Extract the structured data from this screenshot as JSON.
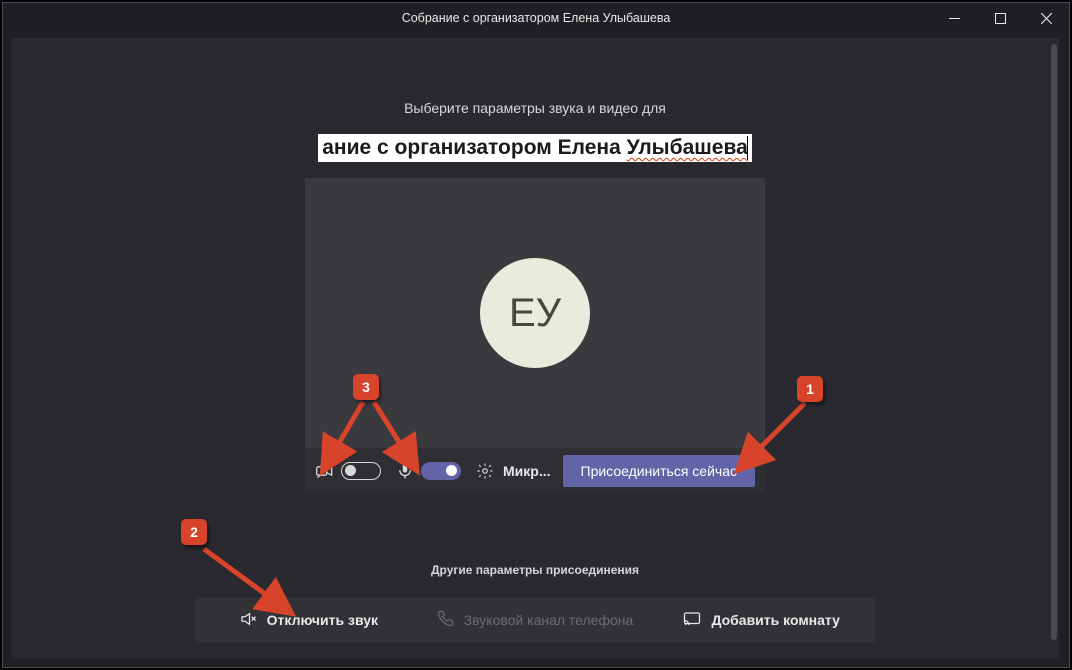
{
  "window": {
    "title": "Собрание с организатором Елена Улыбашева"
  },
  "heading": "Выберите параметры звука и видео для",
  "meeting_name": {
    "prefix": "ание с организатором Елена ",
    "wavy": "Улыбашева"
  },
  "avatar_initials": "ЕУ",
  "controls": {
    "device_label": "Микр...",
    "join_label": "Присоединиться сейчас"
  },
  "other": {
    "heading": "Другие параметры присоединения",
    "mute": "Отключить звук",
    "phone": "Звуковой канал телефона",
    "room": "Добавить комнату"
  },
  "annotations": {
    "a1": "1",
    "a2": "2",
    "a3": "3"
  }
}
